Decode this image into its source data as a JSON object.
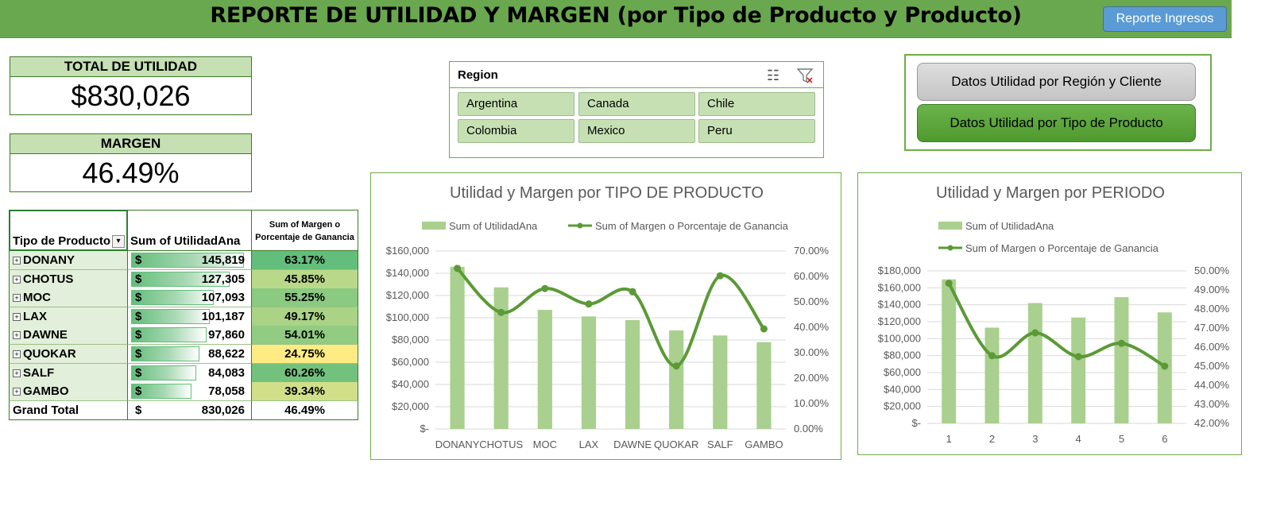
{
  "header": {
    "title": "REPORTE DE UTILIDAD Y MARGEN (por Tipo de Producto y Producto)",
    "button_ingresos": "Reporte Ingresos"
  },
  "kpis": {
    "utilidad_label": "TOTAL DE UTILIDAD",
    "utilidad_value": "$830,026",
    "margen_label": "MARGEN",
    "margen_value": "46.49%"
  },
  "slicer": {
    "title": "Region",
    "items": [
      "Argentina",
      "Canada",
      "Chile",
      "Colombia",
      "Mexico",
      "Peru"
    ],
    "icons": [
      "multi-select-icon",
      "clear-filter-icon"
    ]
  },
  "nav_buttons": {
    "region_cliente": "Datos Utilidad por Región y Cliente",
    "tipo_producto": "Datos Utilidad por Tipo de Producto"
  },
  "pivot": {
    "headers": [
      "Tipo de Producto",
      "Sum of UtilidadAna",
      "Sum of Margen o Porcentaje de Ganancia"
    ],
    "currency": "$",
    "rows": [
      {
        "name": "DONANY",
        "utilidad": "145,819",
        "margen": "63.17%",
        "u": 145819,
        "m": 0.6317
      },
      {
        "name": "CHOTUS",
        "utilidad": "127,305",
        "margen": "45.85%",
        "u": 127305,
        "m": 0.4585
      },
      {
        "name": "MOC",
        "utilidad": "107,093",
        "margen": "55.25%",
        "u": 107093,
        "m": 0.5525
      },
      {
        "name": "LAX",
        "utilidad": "101,187",
        "margen": "49.17%",
        "u": 101187,
        "m": 0.4917
      },
      {
        "name": "DAWNE",
        "utilidad": "97,860",
        "margen": "54.01%",
        "u": 97860,
        "m": 0.5401
      },
      {
        "name": "QUOKAR",
        "utilidad": "88,622",
        "margen": "24.75%",
        "u": 88622,
        "m": 0.2475
      },
      {
        "name": "SALF",
        "utilidad": "84,083",
        "margen": "60.26%",
        "u": 84083,
        "m": 0.6026
      },
      {
        "name": "GAMBO",
        "utilidad": "78,058",
        "margen": "39.34%",
        "u": 78058,
        "m": 0.3934
      }
    ],
    "total": {
      "name": "Grand Total",
      "utilidad": "830,026",
      "margen": "46.49%"
    },
    "colors": {
      "high": "#63be7b",
      "mid": "#c4db8a",
      "low": "#ffeb84"
    }
  },
  "chart_data": [
    {
      "type": "bar",
      "title": "Utilidad y Margen por TIPO DE PRODUCTO",
      "categories": [
        "DONANY",
        "CHOTUS",
        "MOC",
        "LAX",
        "DAWNE",
        "QUOKAR",
        "SALF",
        "GAMBO"
      ],
      "series": [
        {
          "name": "Sum of UtilidadAna",
          "kind": "bar",
          "axis": "left",
          "color": "#a9d08e",
          "values": [
            145819,
            127305,
            107093,
            101187,
            97860,
            88622,
            84083,
            78058
          ]
        },
        {
          "name": "Sum of Margen o Porcentaje de Ganancia",
          "kind": "line",
          "axis": "right",
          "color": "#5b9a36",
          "values": [
            0.6317,
            0.4585,
            0.5525,
            0.4917,
            0.5401,
            0.2475,
            0.6026,
            0.3934
          ]
        }
      ],
      "ylim": [
        0,
        160000
      ],
      "yticks": [
        "$-",
        "$20,000",
        "$40,000",
        "$60,000",
        "$80,000",
        "$100,000",
        "$120,000",
        "$140,000",
        "$160,000"
      ],
      "y2lim": [
        0,
        0.7
      ],
      "y2ticks": [
        "0.00%",
        "10.00%",
        "20.00%",
        "30.00%",
        "40.00%",
        "50.00%",
        "60.00%",
        "70.00%"
      ],
      "legend": "top",
      "grid": true
    },
    {
      "type": "bar",
      "title": "Utilidad y Margen por PERIODO",
      "categories": [
        "1",
        "2",
        "3",
        "4",
        "5",
        "6"
      ],
      "series": [
        {
          "name": "Sum of UtilidadAna",
          "kind": "bar",
          "axis": "left",
          "color": "#a9d08e",
          "values": [
            170000,
            113000,
            142000,
            125000,
            149000,
            131000
          ]
        },
        {
          "name": "Sum of Margen o Porcentaje de Ganancia",
          "kind": "line",
          "axis": "right",
          "color": "#5b9a36",
          "values": [
            0.4935,
            0.4555,
            0.4675,
            0.455,
            0.462,
            0.45
          ]
        }
      ],
      "ylim": [
        0,
        180000
      ],
      "yticks": [
        "$-",
        "$20,000",
        "$40,000",
        "$60,000",
        "$80,000",
        "$100,000",
        "$120,000",
        "$140,000",
        "$160,000",
        "$180,000"
      ],
      "y2lim": [
        0.42,
        0.5
      ],
      "y2ticks": [
        "42.00%",
        "43.00%",
        "44.00%",
        "45.00%",
        "46.00%",
        "47.00%",
        "48.00%",
        "49.00%",
        "50.00%"
      ],
      "legend": "top",
      "grid": true
    }
  ]
}
